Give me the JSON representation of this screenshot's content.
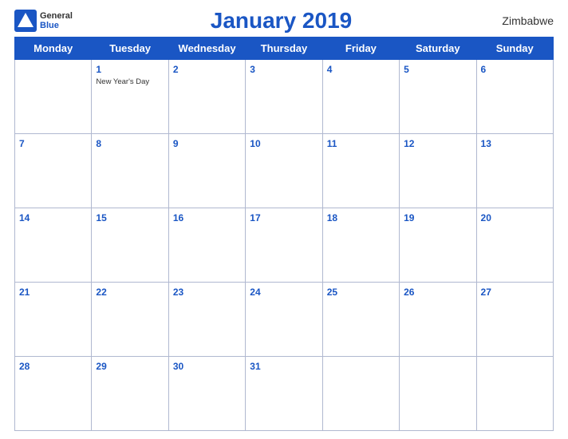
{
  "header": {
    "title": "January 2019",
    "country": "Zimbabwe",
    "logo_general": "General",
    "logo_blue": "Blue"
  },
  "weekdays": [
    "Monday",
    "Tuesday",
    "Wednesday",
    "Thursday",
    "Friday",
    "Saturday",
    "Sunday"
  ],
  "weeks": [
    [
      {
        "day": "",
        "empty": true
      },
      {
        "day": "1",
        "holiday": "New Year's Day"
      },
      {
        "day": "2"
      },
      {
        "day": "3"
      },
      {
        "day": "4"
      },
      {
        "day": "5"
      },
      {
        "day": "6"
      }
    ],
    [
      {
        "day": "7"
      },
      {
        "day": "8"
      },
      {
        "day": "9"
      },
      {
        "day": "10"
      },
      {
        "day": "11"
      },
      {
        "day": "12"
      },
      {
        "day": "13"
      }
    ],
    [
      {
        "day": "14"
      },
      {
        "day": "15"
      },
      {
        "day": "16"
      },
      {
        "day": "17"
      },
      {
        "day": "18"
      },
      {
        "day": "19"
      },
      {
        "day": "20"
      }
    ],
    [
      {
        "day": "21"
      },
      {
        "day": "22"
      },
      {
        "day": "23"
      },
      {
        "day": "24"
      },
      {
        "day": "25"
      },
      {
        "day": "26"
      },
      {
        "day": "27"
      }
    ],
    [
      {
        "day": "28"
      },
      {
        "day": "29"
      },
      {
        "day": "30"
      },
      {
        "day": "31"
      },
      {
        "day": "",
        "empty": true
      },
      {
        "day": "",
        "empty": true
      },
      {
        "day": "",
        "empty": true
      }
    ]
  ]
}
